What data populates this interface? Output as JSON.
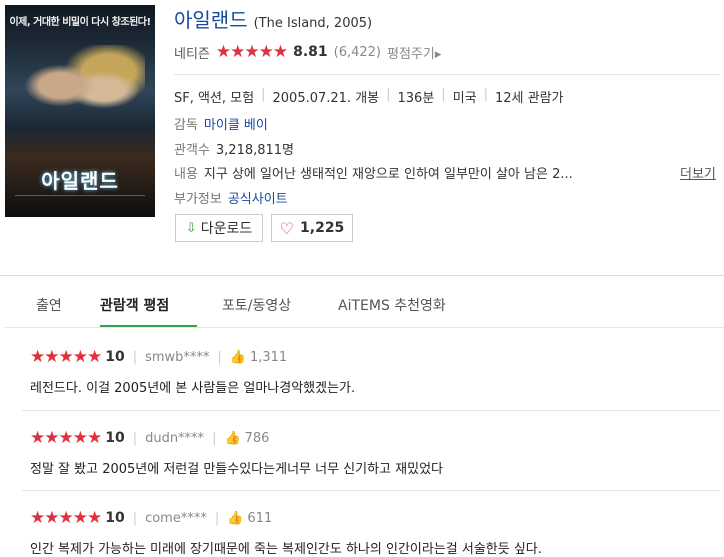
{
  "poster": {
    "tagline": "이제, 거대한 비밀이 다시 창조된다!",
    "title": "아일랜드"
  },
  "movie": {
    "title": "아일랜드",
    "subtitle": "(The Island, 2005)",
    "rating_source": "네티즌",
    "stars": "★★★★★",
    "score": "8.81",
    "count": "(6,422)",
    "rate_button": "평점주기▸",
    "genre": "SF, 액션, 모험",
    "release": "2005.07.21. 개봉",
    "runtime": "136분",
    "country": "미국",
    "age": "12세 관람가",
    "director_label": "감독",
    "director": "마이클 베이",
    "audience_label": "관객수",
    "audience": "3,218,811명",
    "content_label": "내용",
    "content": "지구 상에 일어난 생태적인 재앙으로 인하여 일부만이 살아 남은 2...",
    "more": "더보기",
    "extra_label": "부가정보",
    "extra_link": "공식사이트",
    "download": "다운로드",
    "likes": "1,225"
  },
  "tabs": [
    {
      "label": "출연"
    },
    {
      "label": "관람객 평점"
    },
    {
      "label": "포토/동영상"
    },
    {
      "label": "AiTEMS 추천영화"
    }
  ],
  "reviews": [
    {
      "stars": "★★★★★",
      "score": "10",
      "user": "smwb****",
      "likes": "1,311",
      "text": "레전드다. 이걸 2005년에 본 사람들은 얼마나경악했겠는가."
    },
    {
      "stars": "★★★★★",
      "score": "10",
      "user": "dudn****",
      "likes": "786",
      "text": "정말 잘 봤고 2005년에 저런걸 만들수있다는게너무 너무 신기하고 재밌었다"
    },
    {
      "stars": "★★★★★",
      "score": "10",
      "user": "come****",
      "likes": "611",
      "text": "인간 복제가 가능하는 미래에 장기때문에 죽는 복제인간도 하나의 인간이라는걸 서술한듯 싶다."
    }
  ],
  "colors": {
    "accent_red": "#e0323e",
    "link_blue": "#1a4aa0",
    "tab_green": "#3aa04a"
  }
}
